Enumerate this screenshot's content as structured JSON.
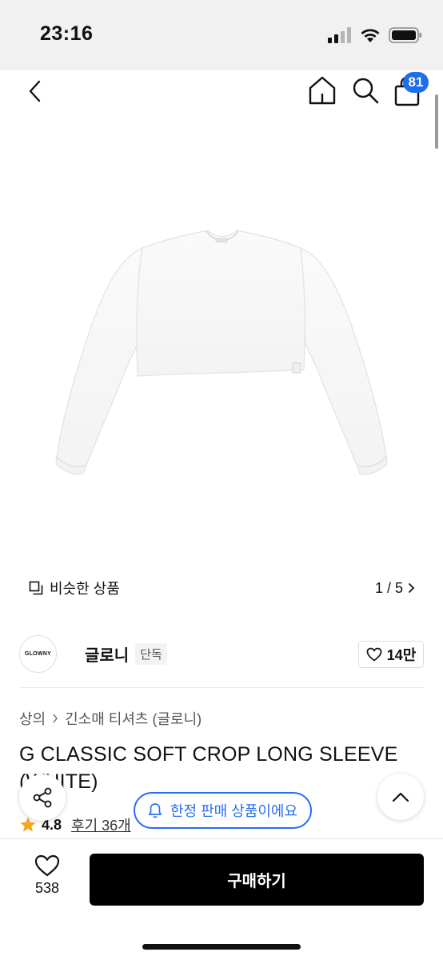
{
  "status_bar": {
    "time": "23:16"
  },
  "nav": {
    "cart_count": "81"
  },
  "gallery": {
    "similar_label": "비슷한 상품",
    "counter": "1 / 5"
  },
  "brand": {
    "logo_text": "GLOWNY",
    "name": "글로니",
    "tag": "단독",
    "likes": "14만"
  },
  "breadcrumb": {
    "category": "상의",
    "subcategory": "긴소매 티셔츠 (글로니)"
  },
  "product": {
    "title": "G CLASSIC SOFT CROP LONG SLEEVE (WHITE)",
    "rating": "4.8",
    "reviews": "후기 36개"
  },
  "floating": {
    "limited_label": "한정 판매 상품이에요"
  },
  "bottom": {
    "wish_count": "538",
    "buy_label": "구매하기"
  },
  "colors": {
    "accent_blue": "#2a6df4",
    "badge_blue": "#1e6cf0",
    "star": "#f5a623",
    "buy_bg": "#000000"
  }
}
